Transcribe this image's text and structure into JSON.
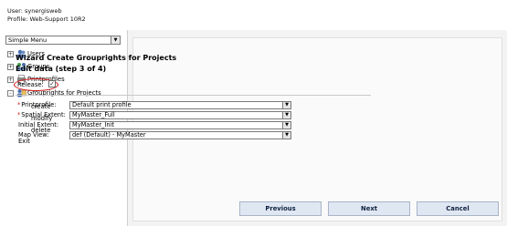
{
  "header": {
    "user_line": "User: synergisweb",
    "profile_line": "Profile: Web-Support 10R2"
  },
  "sidebar": {
    "menu_select": "Simple Menu",
    "items": [
      {
        "label": "Users",
        "expander": "+",
        "icon": "users-icon"
      },
      {
        "label": "Groups",
        "expander": "+",
        "icon": "groups-icon"
      },
      {
        "label": "Printprofiles",
        "expander": "+",
        "icon": "printprofiles-icon"
      },
      {
        "label": "Grouprights for Projects",
        "expander": "-",
        "icon": "grouprights-icon"
      }
    ],
    "sub_items": [
      "create",
      "modify",
      "delete"
    ],
    "exit_label": "Exit"
  },
  "wizard": {
    "title": "Wizard Create Grouprights for Projects",
    "subtitle": "Edit data (step 3 of 4)",
    "release_label": "Release:",
    "release_checked": "✓",
    "fields": [
      {
        "label": "Printprofile:",
        "required": "*",
        "value": "Default print profile"
      },
      {
        "label": "Spatial Extent:",
        "required": "*",
        "value": "MyMaster_Full"
      },
      {
        "label": "Initial Extent:",
        "required": "",
        "value": "MyMaster_Init"
      },
      {
        "label": "Map View:",
        "required": "",
        "value": "def (Default) - MyMaster"
      }
    ]
  },
  "buttons": {
    "previous": "Previous",
    "next": "Next",
    "cancel": "Cancel"
  },
  "colors": {
    "highlight_circle": "#d21a1a",
    "required_star": "#d21a1a",
    "button_bg": "#dfe7f2"
  }
}
